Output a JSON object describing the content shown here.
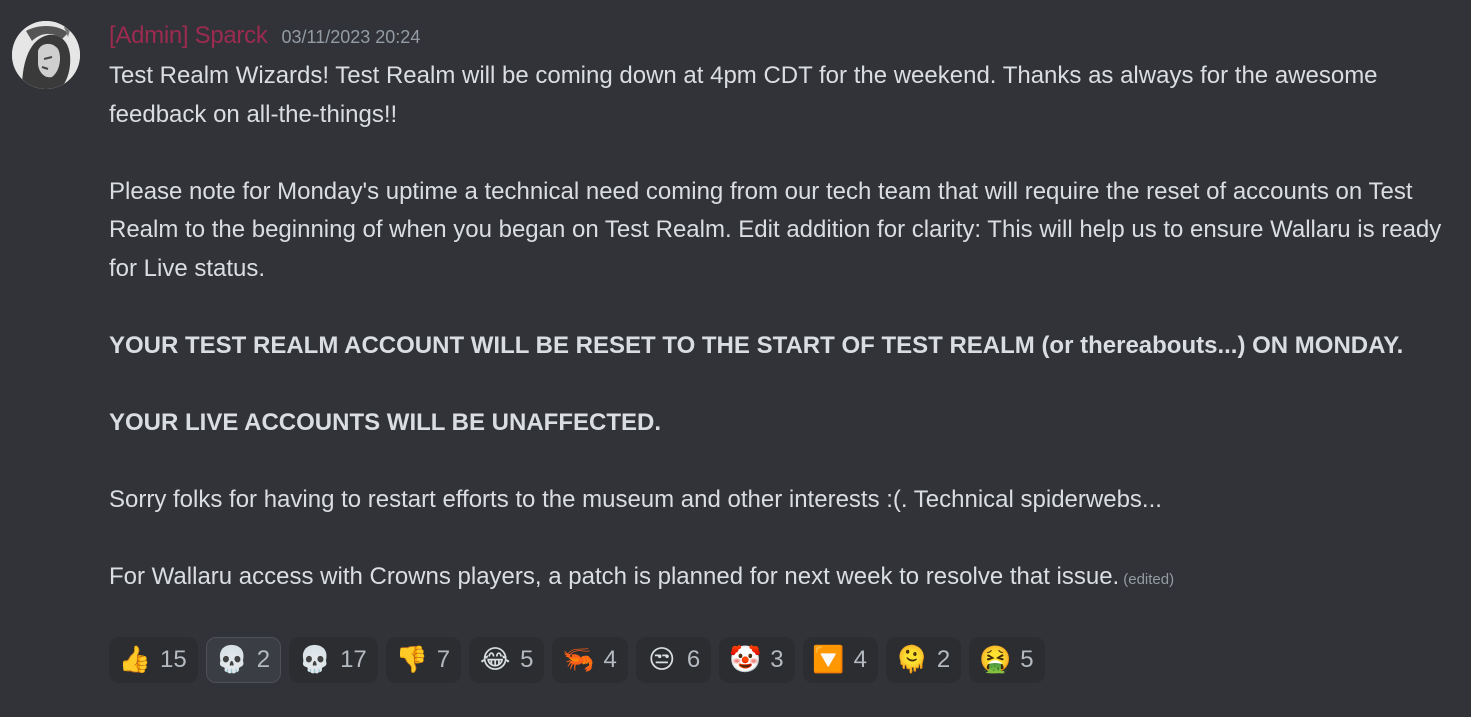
{
  "message": {
    "username": "[Admin] Sparck",
    "timestamp": "03/11/2023 20:24",
    "edited_label": "(edited)",
    "paragraphs": {
      "p1": "Test Realm Wizards! Test Realm will be coming down at 4pm CDT for the weekend. Thanks as always for the awesome feedback on all-the-things!!",
      "p2": "Please note for Monday's uptime a technical need coming from our tech team that will require the reset of accounts on Test Realm to the beginning of when you began on Test Realm. Edit addition for clarity: This will help us to ensure Wallaru is ready for Live status.",
      "p3": "YOUR TEST REALM ACCOUNT WILL BE RESET TO THE START OF TEST REALM (or thereabouts...) ON MONDAY.",
      "p4": "YOUR LIVE ACCOUNTS WILL BE UNAFFECTED.",
      "p5": "Sorry folks for having to restart efforts to the museum and other interests :(. Technical spiderwebs...",
      "p6": "For Wallaru access with Crowns players, a patch is planned for next week to resolve that issue."
    }
  },
  "colors": {
    "background": "#313338",
    "username": "#9d2a4f",
    "text": "#dbdee1",
    "muted": "#949ba4",
    "reaction_bg": "#2b2d31"
  },
  "reactions": [
    {
      "emoji": "👍",
      "icon": "thumbs-up-icon",
      "count": "15"
    },
    {
      "emoji": "💀",
      "icon": "skull-icon",
      "count": "2",
      "selected": true
    },
    {
      "emoji": "💀",
      "icon": "skull-icon",
      "count": "17"
    },
    {
      "emoji": "👎",
      "icon": "thumbs-down-icon",
      "count": "7"
    },
    {
      "emoji": "😂",
      "icon": "tears-of-joy-icon",
      "count": "5"
    },
    {
      "emoji": "🦐",
      "icon": "shrimp-icon",
      "count": "4"
    },
    {
      "emoji": "😒",
      "icon": "unamused-face-icon",
      "count": "6"
    },
    {
      "emoji": "🤡",
      "icon": "clown-face-icon",
      "count": "3"
    },
    {
      "emoji": "🔽",
      "icon": "down-arrow-button-icon",
      "count": "4"
    },
    {
      "emoji": "🫠",
      "icon": "melting-face-icon",
      "count": "2"
    },
    {
      "emoji": "🤮",
      "icon": "vomiting-face-icon",
      "count": "5"
    }
  ]
}
